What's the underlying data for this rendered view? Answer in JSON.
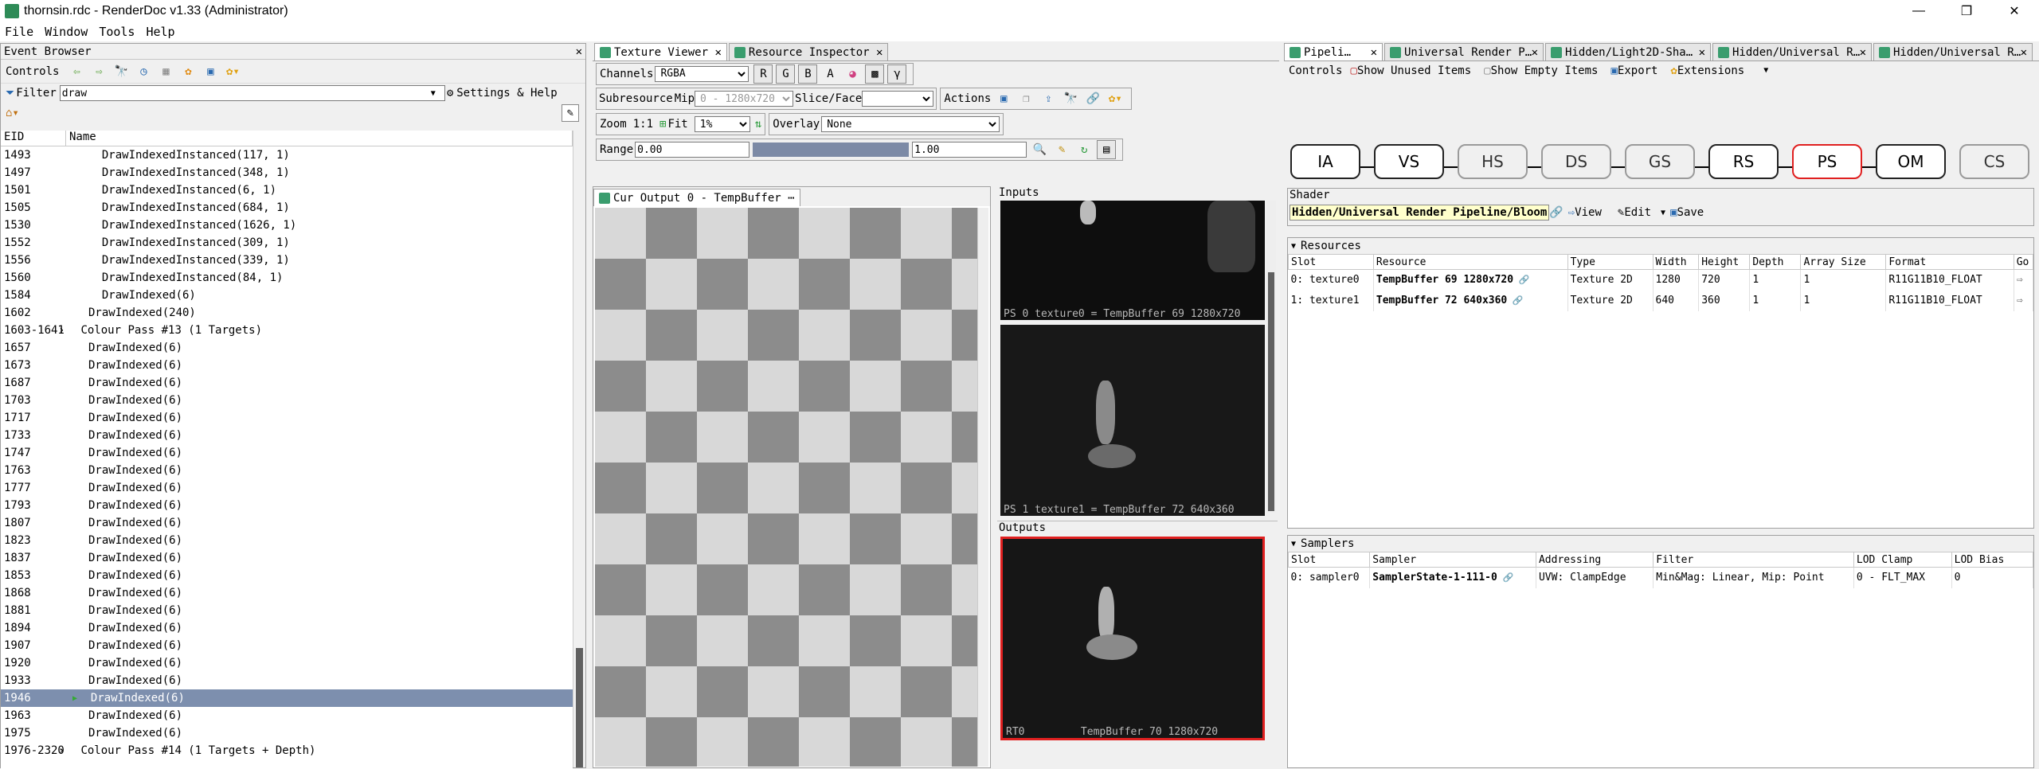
{
  "window": {
    "title": "thornsin.rdc - RenderDoc v1.33 (Administrator)",
    "min": "—",
    "max": "❐",
    "close": "✕"
  },
  "menu": [
    "File",
    "Window",
    "Tools",
    "Help"
  ],
  "event_browser": {
    "title": "Event Browser",
    "controls_label": "Controls",
    "filter_label": "Filter",
    "filter_value": "draw",
    "settings_help": "Settings & Help",
    "col_eid": "EID",
    "col_name": "Name",
    "rows": [
      {
        "eid": "1493",
        "name": "  DrawIndexedInstanced(117, 1)"
      },
      {
        "eid": "1497",
        "name": "  DrawIndexedInstanced(348, 1)"
      },
      {
        "eid": "1501",
        "name": "  DrawIndexedInstanced(6, 1)"
      },
      {
        "eid": "1505",
        "name": "  DrawIndexedInstanced(684, 1)"
      },
      {
        "eid": "1530",
        "name": "  DrawIndexedInstanced(1626, 1)"
      },
      {
        "eid": "1552",
        "name": "  DrawIndexedInstanced(309, 1)"
      },
      {
        "eid": "1556",
        "name": "  DrawIndexedInstanced(339, 1)"
      },
      {
        "eid": "1560",
        "name": "  DrawIndexedInstanced(84, 1)"
      },
      {
        "eid": "1584",
        "name": "  DrawIndexed(6)"
      },
      {
        "eid": "1602",
        "name": "DrawIndexed(240)"
      },
      {
        "eid": "1603-1641",
        "name": "Colour Pass #13 (1 Targets)",
        "group": true
      },
      {
        "eid": "1657",
        "name": "DrawIndexed(6)"
      },
      {
        "eid": "1673",
        "name": "DrawIndexed(6)"
      },
      {
        "eid": "1687",
        "name": "DrawIndexed(6)"
      },
      {
        "eid": "1703",
        "name": "DrawIndexed(6)"
      },
      {
        "eid": "1717",
        "name": "DrawIndexed(6)"
      },
      {
        "eid": "1733",
        "name": "DrawIndexed(6)"
      },
      {
        "eid": "1747",
        "name": "DrawIndexed(6)"
      },
      {
        "eid": "1763",
        "name": "DrawIndexed(6)"
      },
      {
        "eid": "1777",
        "name": "DrawIndexed(6)"
      },
      {
        "eid": "1793",
        "name": "DrawIndexed(6)"
      },
      {
        "eid": "1807",
        "name": "DrawIndexed(6)"
      },
      {
        "eid": "1823",
        "name": "DrawIndexed(6)"
      },
      {
        "eid": "1837",
        "name": "DrawIndexed(6)"
      },
      {
        "eid": "1853",
        "name": "DrawIndexed(6)"
      },
      {
        "eid": "1868",
        "name": "DrawIndexed(6)"
      },
      {
        "eid": "1881",
        "name": "DrawIndexed(6)"
      },
      {
        "eid": "1894",
        "name": "DrawIndexed(6)"
      },
      {
        "eid": "1907",
        "name": "DrawIndexed(6)"
      },
      {
        "eid": "1920",
        "name": "DrawIndexed(6)"
      },
      {
        "eid": "1933",
        "name": "DrawIndexed(6)"
      },
      {
        "eid": "1946",
        "name": "  DrawIndexed(6)",
        "selected": true
      },
      {
        "eid": "1963",
        "name": "DrawIndexed(6)"
      },
      {
        "eid": "1975",
        "name": "DrawIndexed(6)"
      },
      {
        "eid": "1976-2320",
        "name": "Colour Pass #14 (1 Targets + Depth)",
        "group": true
      }
    ]
  },
  "texture_viewer": {
    "tabs": [
      "Texture Viewer",
      "Resource Inspector"
    ],
    "channels_label": "Channels",
    "channels_value": "RGBA",
    "ch_r": "R",
    "ch_g": "G",
    "ch_b": "B",
    "ch_a": "A",
    "gamma": "γ",
    "subresource_label": "Subresource",
    "mip_label": "Mip",
    "mip_value": "0 - 1280x720",
    "slice_label": "Slice/Face",
    "actions_label": "Actions",
    "zoom_label": "Zoom",
    "zoom_11": "1:1",
    "fit_label": "Fit",
    "zoom_value": "1%",
    "overlay_label": "Overlay",
    "overlay_value": "None",
    "range_label": "Range",
    "range_min": "0.00",
    "range_max": "1.00",
    "output_tab": "Cur Output 0 - TempBuffer",
    "inputs_label": "Inputs",
    "outputs_label": "Outputs",
    "input0_caption": "PS 0 texture0 = TempBuffer 69 1280x720",
    "input1_caption": "PS 1 texture1 = TempBuffer 72 640x360",
    "output0_caption": "RT0         TempBuffer 70 1280x720"
  },
  "pipeline": {
    "tabs": [
      "Pipeli…",
      "Universal Render P…",
      "Hidden/Light2D-Sha…",
      "Hidden/Universal R…",
      "Hidden/Universal R…"
    ],
    "controls_label": "Controls",
    "show_unused": "Show Unused Items",
    "show_empty": "Show Empty Items",
    "export": "Export",
    "extensions": "Extensions",
    "stages": [
      "IA",
      "VS",
      "HS",
      "DS",
      "GS",
      "RS",
      "PS",
      "OM",
      "CS"
    ],
    "shader_label": "Shader",
    "shader_name": "Hidden/Universal Render Pipeline/Bloom",
    "view": "View",
    "edit": "Edit",
    "save": "Save",
    "resources_label": "Resources",
    "res_cols": [
      "Slot",
      "Resource",
      "Type",
      "Width",
      "Height",
      "Depth",
      "Array Size",
      "Format",
      "Go"
    ],
    "res_rows": [
      [
        "0: texture0",
        "TempBuffer 69 1280x720",
        "Texture 2D",
        "1280",
        "720",
        "1",
        "1",
        "R11G11B10_FLOAT"
      ],
      [
        "1: texture1",
        "TempBuffer 72 640x360",
        "Texture 2D",
        "640",
        "360",
        "1",
        "1",
        "R11G11B10_FLOAT"
      ]
    ],
    "samplers_label": "Samplers",
    "samp_cols": [
      "Slot",
      "Sampler",
      "Addressing",
      "Filter",
      "LOD Clamp",
      "LOD Bias"
    ],
    "samp_rows": [
      [
        "0: sampler0",
        "SamplerState-1-111-0",
        "UVW: ClampEdge",
        "Min&Mag: Linear, Mip: Point",
        "0 - FLT_MAX",
        "0"
      ]
    ]
  }
}
